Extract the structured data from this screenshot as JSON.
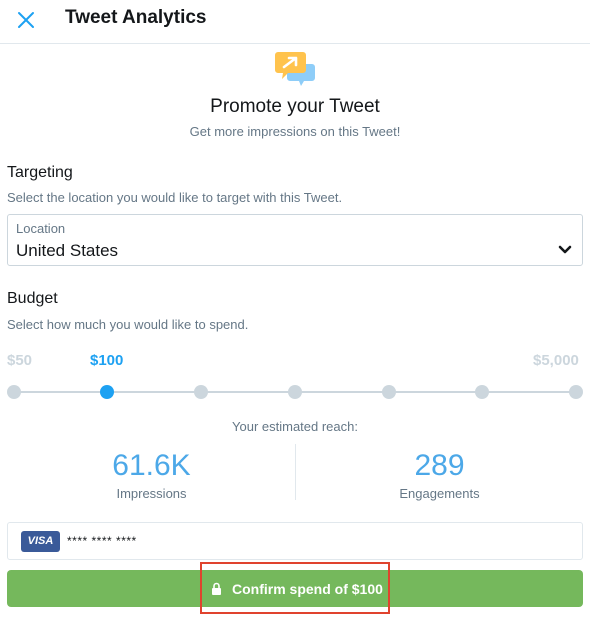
{
  "header": {
    "title": "Tweet Analytics",
    "close_icon": "close-icon"
  },
  "promo": {
    "icon": "promote-icon",
    "title": "Promote your Tweet",
    "subtitle": "Get more impressions on this Tweet!"
  },
  "targeting": {
    "title": "Targeting",
    "description": "Select the location you would like to target with this Tweet.",
    "location_label": "Location",
    "location_value": "United States"
  },
  "budget": {
    "title": "Budget",
    "description": "Select how much you would like to spend.",
    "min_label": "$50",
    "selected_label": "$100",
    "max_label": "$5,000",
    "steps": 7,
    "selected_index": 1
  },
  "reach": {
    "label": "Your estimated reach:",
    "impressions_value": "61.6K",
    "impressions_label": "Impressions",
    "engagements_value": "289",
    "engagements_label": "Engagements"
  },
  "payment": {
    "card_brand": "VISA",
    "card_mask": "**** **** ****"
  },
  "confirm": {
    "label": "Confirm spend of $100",
    "icon": "lock-icon"
  },
  "colors": {
    "accent": "#1da1f2",
    "confirm": "#75b85c",
    "highlight": "#e0432e",
    "card_brand": "#3a5a99"
  }
}
